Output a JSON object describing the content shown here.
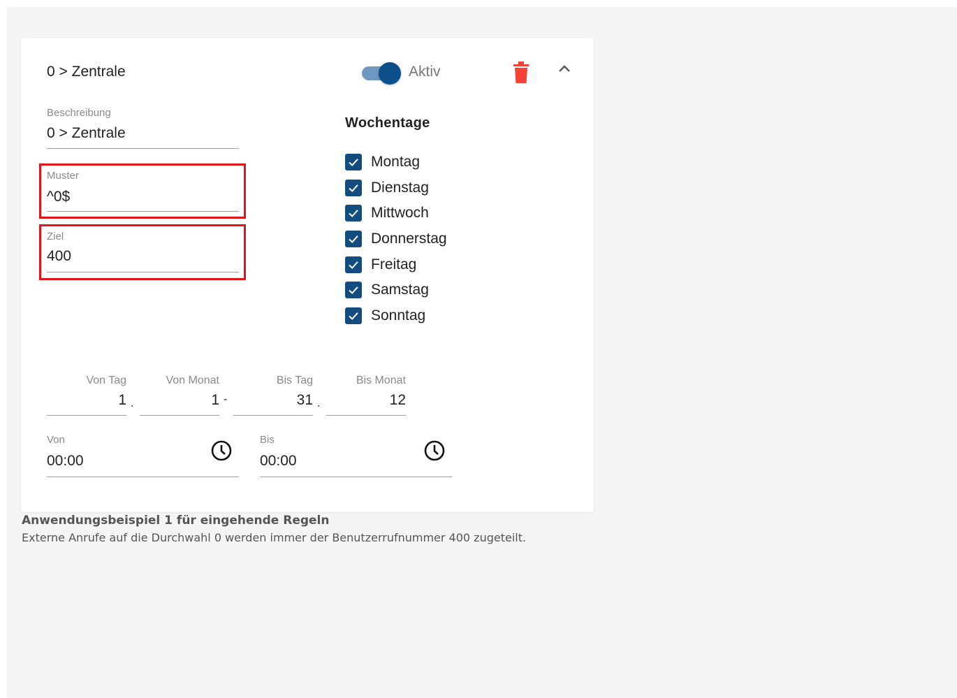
{
  "rule": {
    "title": "0 > Zentrale",
    "active_label": "Aktiv",
    "active": true
  },
  "fields": {
    "description_label": "Beschreibung",
    "description_value": "0 > Zentrale",
    "pattern_label": "Muster",
    "pattern_value": "^0$",
    "target_label": "Ziel",
    "target_value": "400"
  },
  "weekdays": {
    "title": "Wochentage",
    "items": [
      {
        "label": "Montag",
        "checked": true
      },
      {
        "label": "Dienstag",
        "checked": true
      },
      {
        "label": "Mittwoch",
        "checked": true
      },
      {
        "label": "Donnerstag",
        "checked": true
      },
      {
        "label": "Freitag",
        "checked": true
      },
      {
        "label": "Samstag",
        "checked": true
      },
      {
        "label": "Sonntag",
        "checked": true
      }
    ]
  },
  "date_range": {
    "from_day_label": "Von Tag",
    "from_day_value": "1",
    "from_month_label": "Von Monat",
    "from_month_value": "1",
    "to_day_label": "Bis Tag",
    "to_day_value": "31",
    "to_month_label": "Bis Monat",
    "to_month_value": "12",
    "sep_dot": ".",
    "sep_dash": "-"
  },
  "time_range": {
    "from_label": "Von",
    "from_value": "00:00",
    "to_label": "Bis",
    "to_value": "00:00"
  },
  "caption": {
    "title": "Anwendungsbeispiel 1 für eingehende Regeln",
    "text": "Externe Anrufe auf die Durchwahl 0 werden immer der Benutzerrufnummer 400 zugeteilt."
  },
  "colors": {
    "accent": "#134d80",
    "delete": "#f44336",
    "highlight": "#e3131c"
  },
  "icons": [
    "trash-icon",
    "chevron-up-icon",
    "clock-icon",
    "check-icon"
  ]
}
